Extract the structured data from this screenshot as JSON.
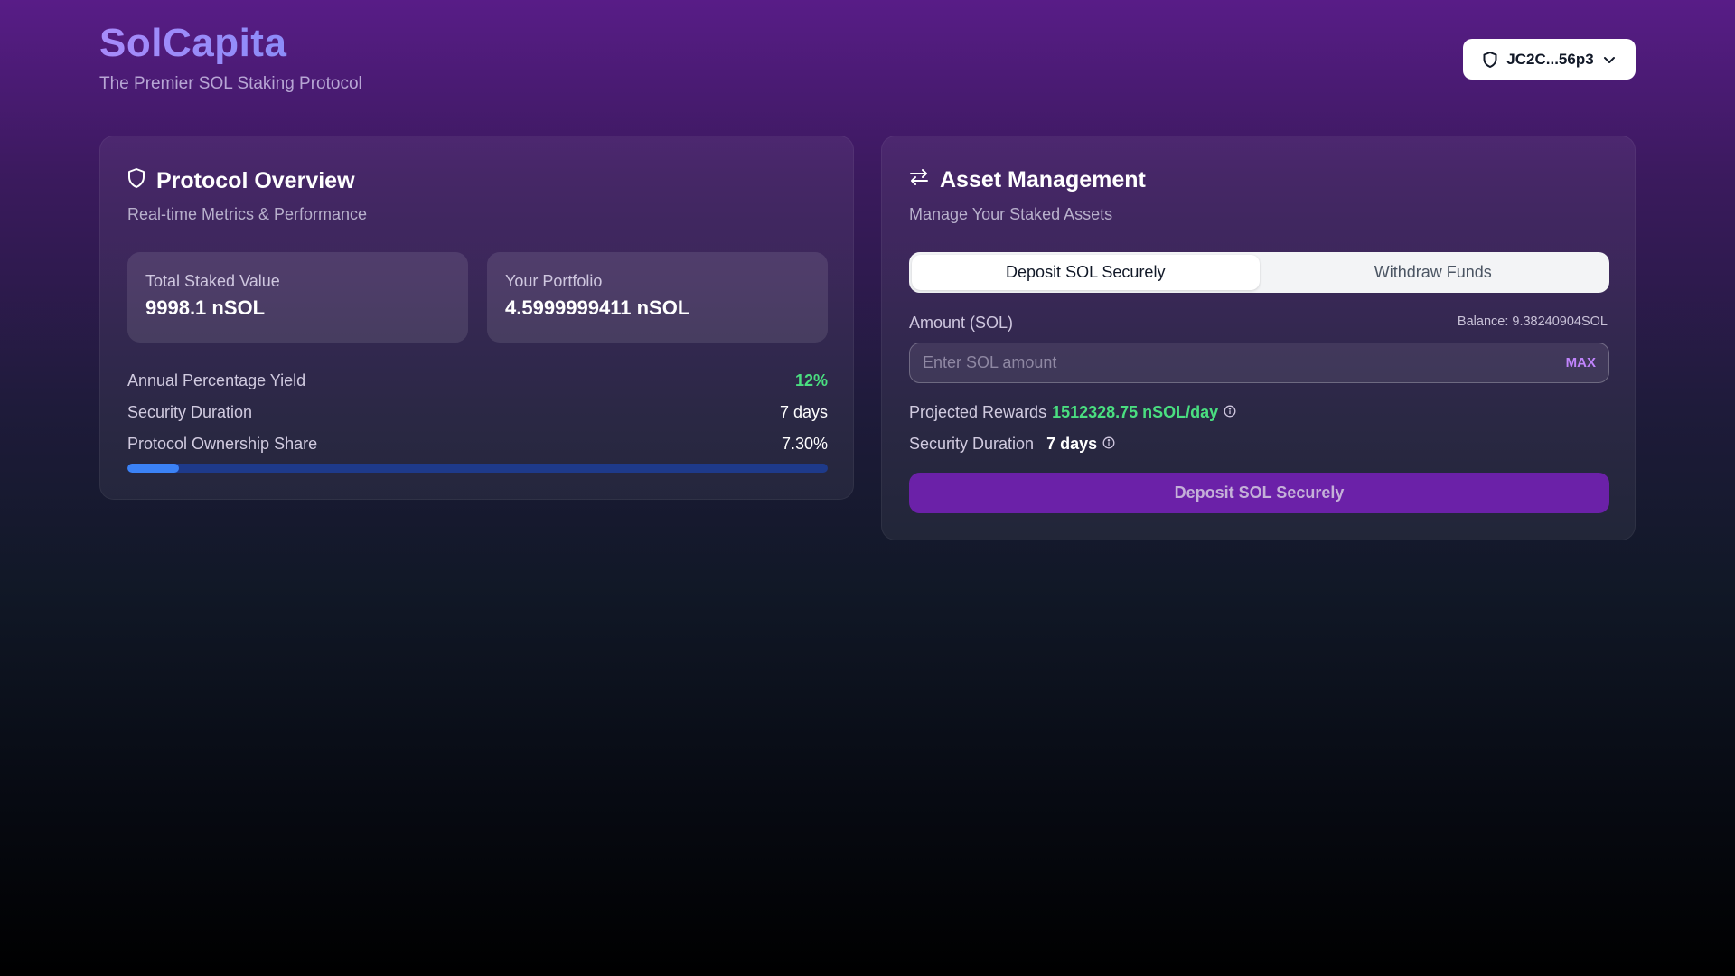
{
  "header": {
    "brand": "SolCapita",
    "tagline": "The Premier SOL Staking Protocol",
    "wallet_label": "JC2C...56p3",
    "wallet_icon": "shield-icon"
  },
  "overview": {
    "title": "Protocol Overview",
    "subtitle": "Real-time Metrics & Performance",
    "total_staked_label": "Total Staked Value",
    "total_staked_value": "9998.1 nSOL",
    "portfolio_label": "Your Portfolio",
    "portfolio_value": "4.5999999411 nSOL",
    "metrics": [
      {
        "label": "Annual Percentage Yield",
        "value": "12%"
      },
      {
        "label": "Security Duration",
        "value": "7 days"
      },
      {
        "label": "Protocol Ownership Share",
        "value": "7.30%"
      }
    ],
    "ownership_progress": 0.073
  },
  "asset": {
    "title": "Asset Management",
    "subtitle": "Manage Your Staked Assets",
    "tabs": [
      {
        "label": "Deposit SOL Securely",
        "active": true
      },
      {
        "label": "Withdraw Funds",
        "active": false
      }
    ],
    "amount_label": "Amount (SOL)",
    "balance": "Balance: 9.38240904SOL",
    "amount_value": "",
    "amount_placeholder": "Enter SOL amount",
    "max_label": "MAX",
    "rewards_label": "Projected Rewards",
    "rewards_value": "1512328.75 nSOL/day",
    "duration_label": "Security Duration",
    "duration_value": "7 days",
    "deposit_button": "Deposit SOL Securely"
  },
  "colors": {
    "accent_green": "#4ade80",
    "accent_purple": "#6b21a8",
    "progress_blue": "#3b82f6"
  }
}
